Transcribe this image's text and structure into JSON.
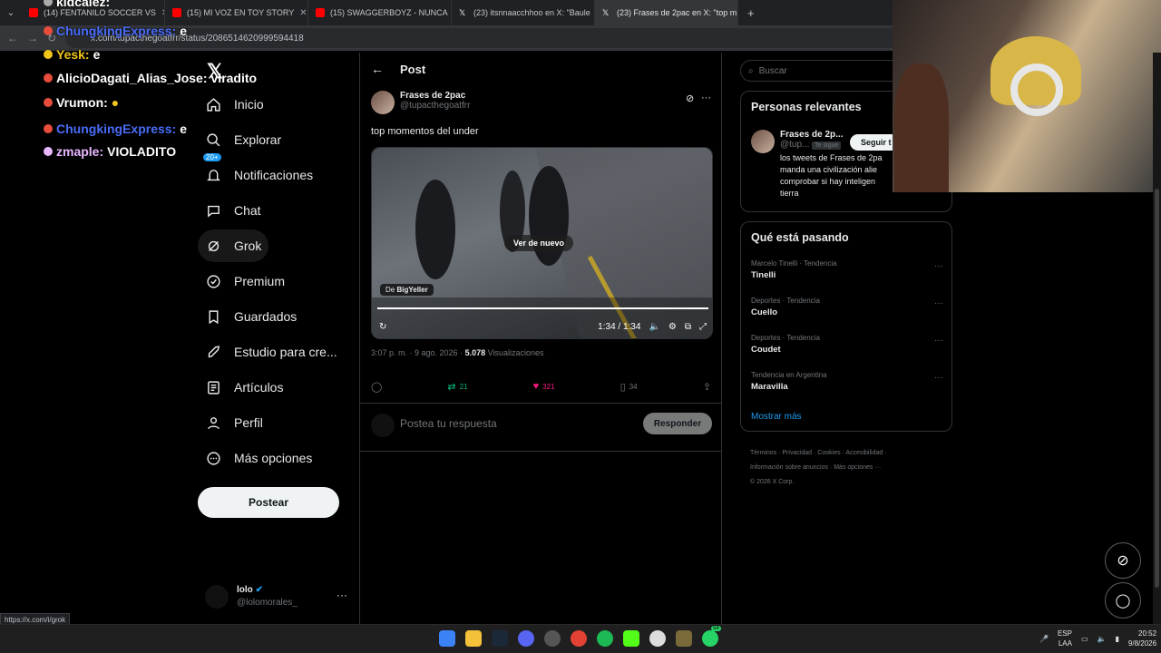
{
  "browser": {
    "tabs": [
      {
        "label": "(14) FENTANILO SOCCER VS",
        "color": "#ff0000"
      },
      {
        "label": "(15) MI VOZ EN TOY STORY",
        "color": "#ff0000"
      },
      {
        "label": "(15) SWAGGERBOYZ - NUNCA",
        "color": "#ff0000"
      },
      {
        "label": "(23) itsnnaacchhoo en X: \"Baule",
        "color": "#ffffff"
      },
      {
        "label": "(23) Frases de 2pac en X: \"top m",
        "color": "#ffffff"
      }
    ],
    "new_tab": "+",
    "url": "x.com/tupacthegoatfrr/status/2086514620999594418",
    "status_url": "https://x.com/i/grok"
  },
  "chat_overlay": [
    {
      "user": "kidcalez:",
      "msg": "",
      "color": "#ffffff"
    },
    {
      "user": "ChungkingExpress:",
      "msg": "e",
      "color": "#4a6cf7"
    },
    {
      "user": "Yesk:",
      "msg": "e",
      "color": "#f0c419"
    },
    {
      "user": "AlicioDagati_Alias_Jose:",
      "msg": "viradito",
      "color": "#ffffff"
    },
    {
      "user": "Vrumon:",
      "msg": "",
      "color": "#ffffff"
    },
    {
      "user": "ChungkingExpress:",
      "msg": "e",
      "color": "#4a6cf7"
    },
    {
      "user": "zmaple:",
      "msg": "VIOLADITO",
      "color": "#e8b7ff"
    }
  ],
  "sidebar": {
    "items": [
      {
        "label": "Inicio",
        "icon": "home-icon"
      },
      {
        "label": "Explorar",
        "icon": "search-icon"
      },
      {
        "label": "Notificaciones",
        "icon": "bell-icon",
        "badge": "20+"
      },
      {
        "label": "Chat",
        "icon": "chat-icon"
      },
      {
        "label": "Grok",
        "icon": "grok-icon"
      },
      {
        "label": "Premium",
        "icon": "premium-icon"
      },
      {
        "label": "Guardados",
        "icon": "bookmark-icon"
      },
      {
        "label": "Estudio para cre...",
        "icon": "rocket-icon"
      },
      {
        "label": "Artículos",
        "icon": "article-icon"
      },
      {
        "label": "Perfil",
        "icon": "person-icon"
      },
      {
        "label": "Más opciones",
        "icon": "more-icon"
      }
    ],
    "post_button": "Postear",
    "account": {
      "name": "lolo",
      "handle": "@lolomorales_"
    }
  },
  "main": {
    "title": "Post",
    "author": {
      "name": "Frases de 2pac",
      "handle": "@tupacthegoatfrr"
    },
    "text": "top momentos del under",
    "media": {
      "replay_label": "Ver de nuevo",
      "source_prefix": "De",
      "source_name": "BigYeller",
      "time": "1:34 / 1:34",
      "progress": 1.0
    },
    "meta": {
      "datetime": "3:07 p. m. · 9 ago. 2026 · ",
      "views": "5.078",
      "views_label": " Visualizaciones"
    },
    "stats": {
      "reposts": "21",
      "likes": "321",
      "bookmarks": "34"
    },
    "reply_placeholder": "Postea tu respuesta",
    "reply_button": "Responder"
  },
  "right": {
    "search_placeholder": "Buscar",
    "relevant_title": "Personas relevantes",
    "relevant_user": {
      "name": "Frases de 2p...",
      "handle": "@tup...",
      "follows_you": "Te sigue",
      "follow_button": "Seguir t",
      "bio": "los tweets de Frases de 2pa manda una civilización alie comprobar si hay inteligen tierra"
    },
    "trends_title": "Qué está pasando",
    "trends": [
      {
        "context": "Marcelo Tinelli · Tendencia",
        "topic": "Tinelli"
      },
      {
        "context": "Deportes · Tendencia",
        "topic": "Cuello"
      },
      {
        "context": "Deportes · Tendencia",
        "topic": "Coudet"
      },
      {
        "context": "Tendencia en Argentina",
        "topic": "Maravilla"
      }
    ],
    "show_more": "Mostrar más",
    "footer_line1": "Términos · Privacidad · Cookies · Accesibilidad ·",
    "footer_line2": "Información sobre anuncios · Más opciones ···",
    "footer_line3": "© 2026 X Corp."
  },
  "taskbar": {
    "lang_top": "ESP",
    "lang_bottom": "LAA",
    "time": "20:52",
    "date": "9/8/2026",
    "badge": "58"
  }
}
